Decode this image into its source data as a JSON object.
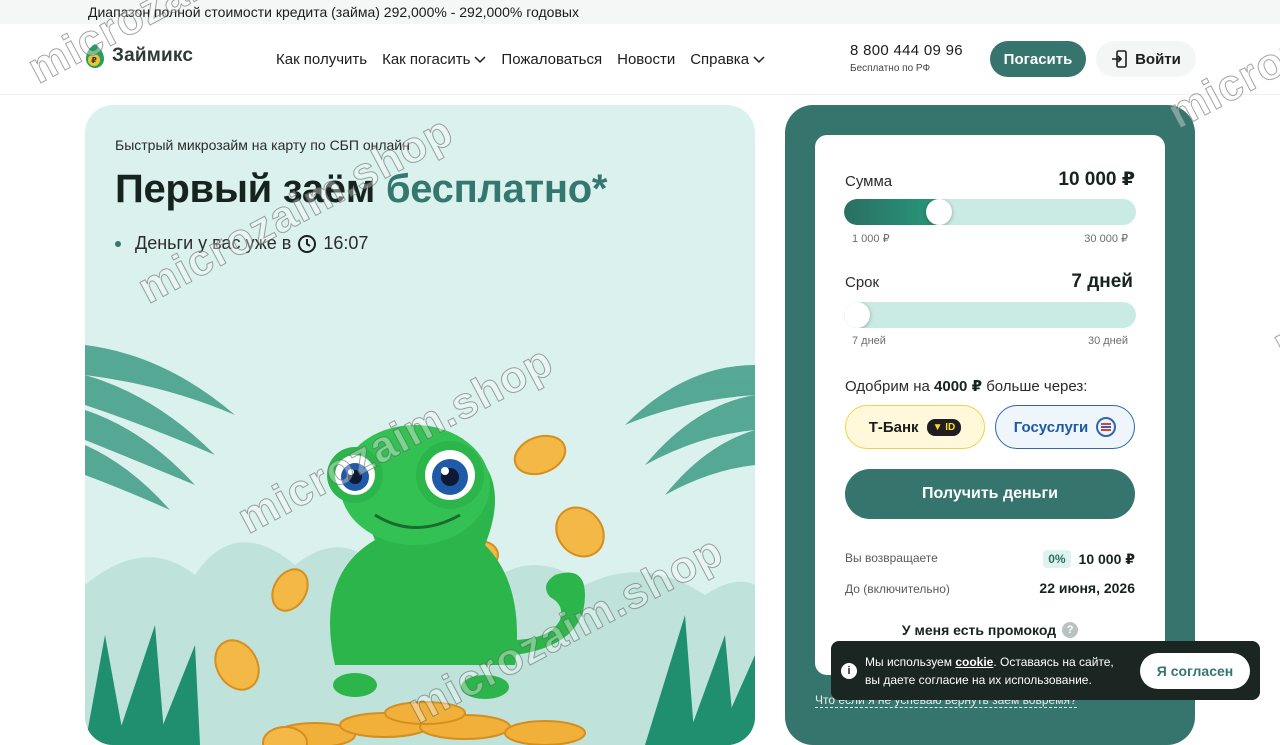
{
  "topbar": {
    "text": "Диапазон полной стоимости кредита (займа) 292,000% - 292,000% годовых"
  },
  "header": {
    "logo_text": "Займикс",
    "nav": [
      {
        "label": "Как получить",
        "has_dropdown": false
      },
      {
        "label": "Как погасить",
        "has_dropdown": true
      },
      {
        "label": "Пожаловаться",
        "has_dropdown": false
      },
      {
        "label": "Новости",
        "has_dropdown": false
      },
      {
        "label": "Справка",
        "has_dropdown": true
      }
    ],
    "phone": "8 800 444 09 96",
    "phone_note": "Бесплатно по РФ",
    "pay_label": "Погасить",
    "login_label": "Войти"
  },
  "hero": {
    "subtitle": "Быстрый микрозайм на карту по СБП онлайн",
    "title_main": "Первый заём",
    "title_accent": "бесплатно*",
    "bullet_text": "Деньги у вас уже в",
    "bullet_time": "16:07"
  },
  "calculator": {
    "amount_label": "Сумма",
    "amount_value": "10 000 ₽",
    "amount_fraction": 0.31,
    "amount_min": "1 000 ₽",
    "amount_max": "30 000 ₽",
    "term_label": "Срок",
    "term_value": "7 дней",
    "term_fraction": 0.0,
    "term_min": "7 дней",
    "term_max": "30 дней",
    "approve_prefix": "Одобрим на",
    "approve_amount": "4000 ₽",
    "approve_suffix": "больше через:",
    "tbank_label": "Т-Банк",
    "tbank_badge": "ID",
    "gos_label": "Госуслуги",
    "get_money_label": "Получить деньги",
    "return_label": "Вы возвращаете",
    "return_percent": "0%",
    "return_value": "10 000 ₽",
    "until_label": "До (включительно)",
    "until_value": "22 июня, 2026",
    "promo_label": "У меня есть промокод",
    "late_link": "Что если я не успеваю вернуть заем вовремя?"
  },
  "cookie": {
    "text_before": "Мы используем",
    "link": "cookie",
    "text_after": ". Оставаясь на сайте, вы даете согласие на их использование.",
    "agree_label": "Я согласен"
  },
  "watermark": {
    "text": "microzaim.shop"
  },
  "colors": {
    "brand": "#36756d",
    "accent_text": "#33776e",
    "hero_bg": "#dbf1ed",
    "slider_track": "#c9ebe4"
  }
}
